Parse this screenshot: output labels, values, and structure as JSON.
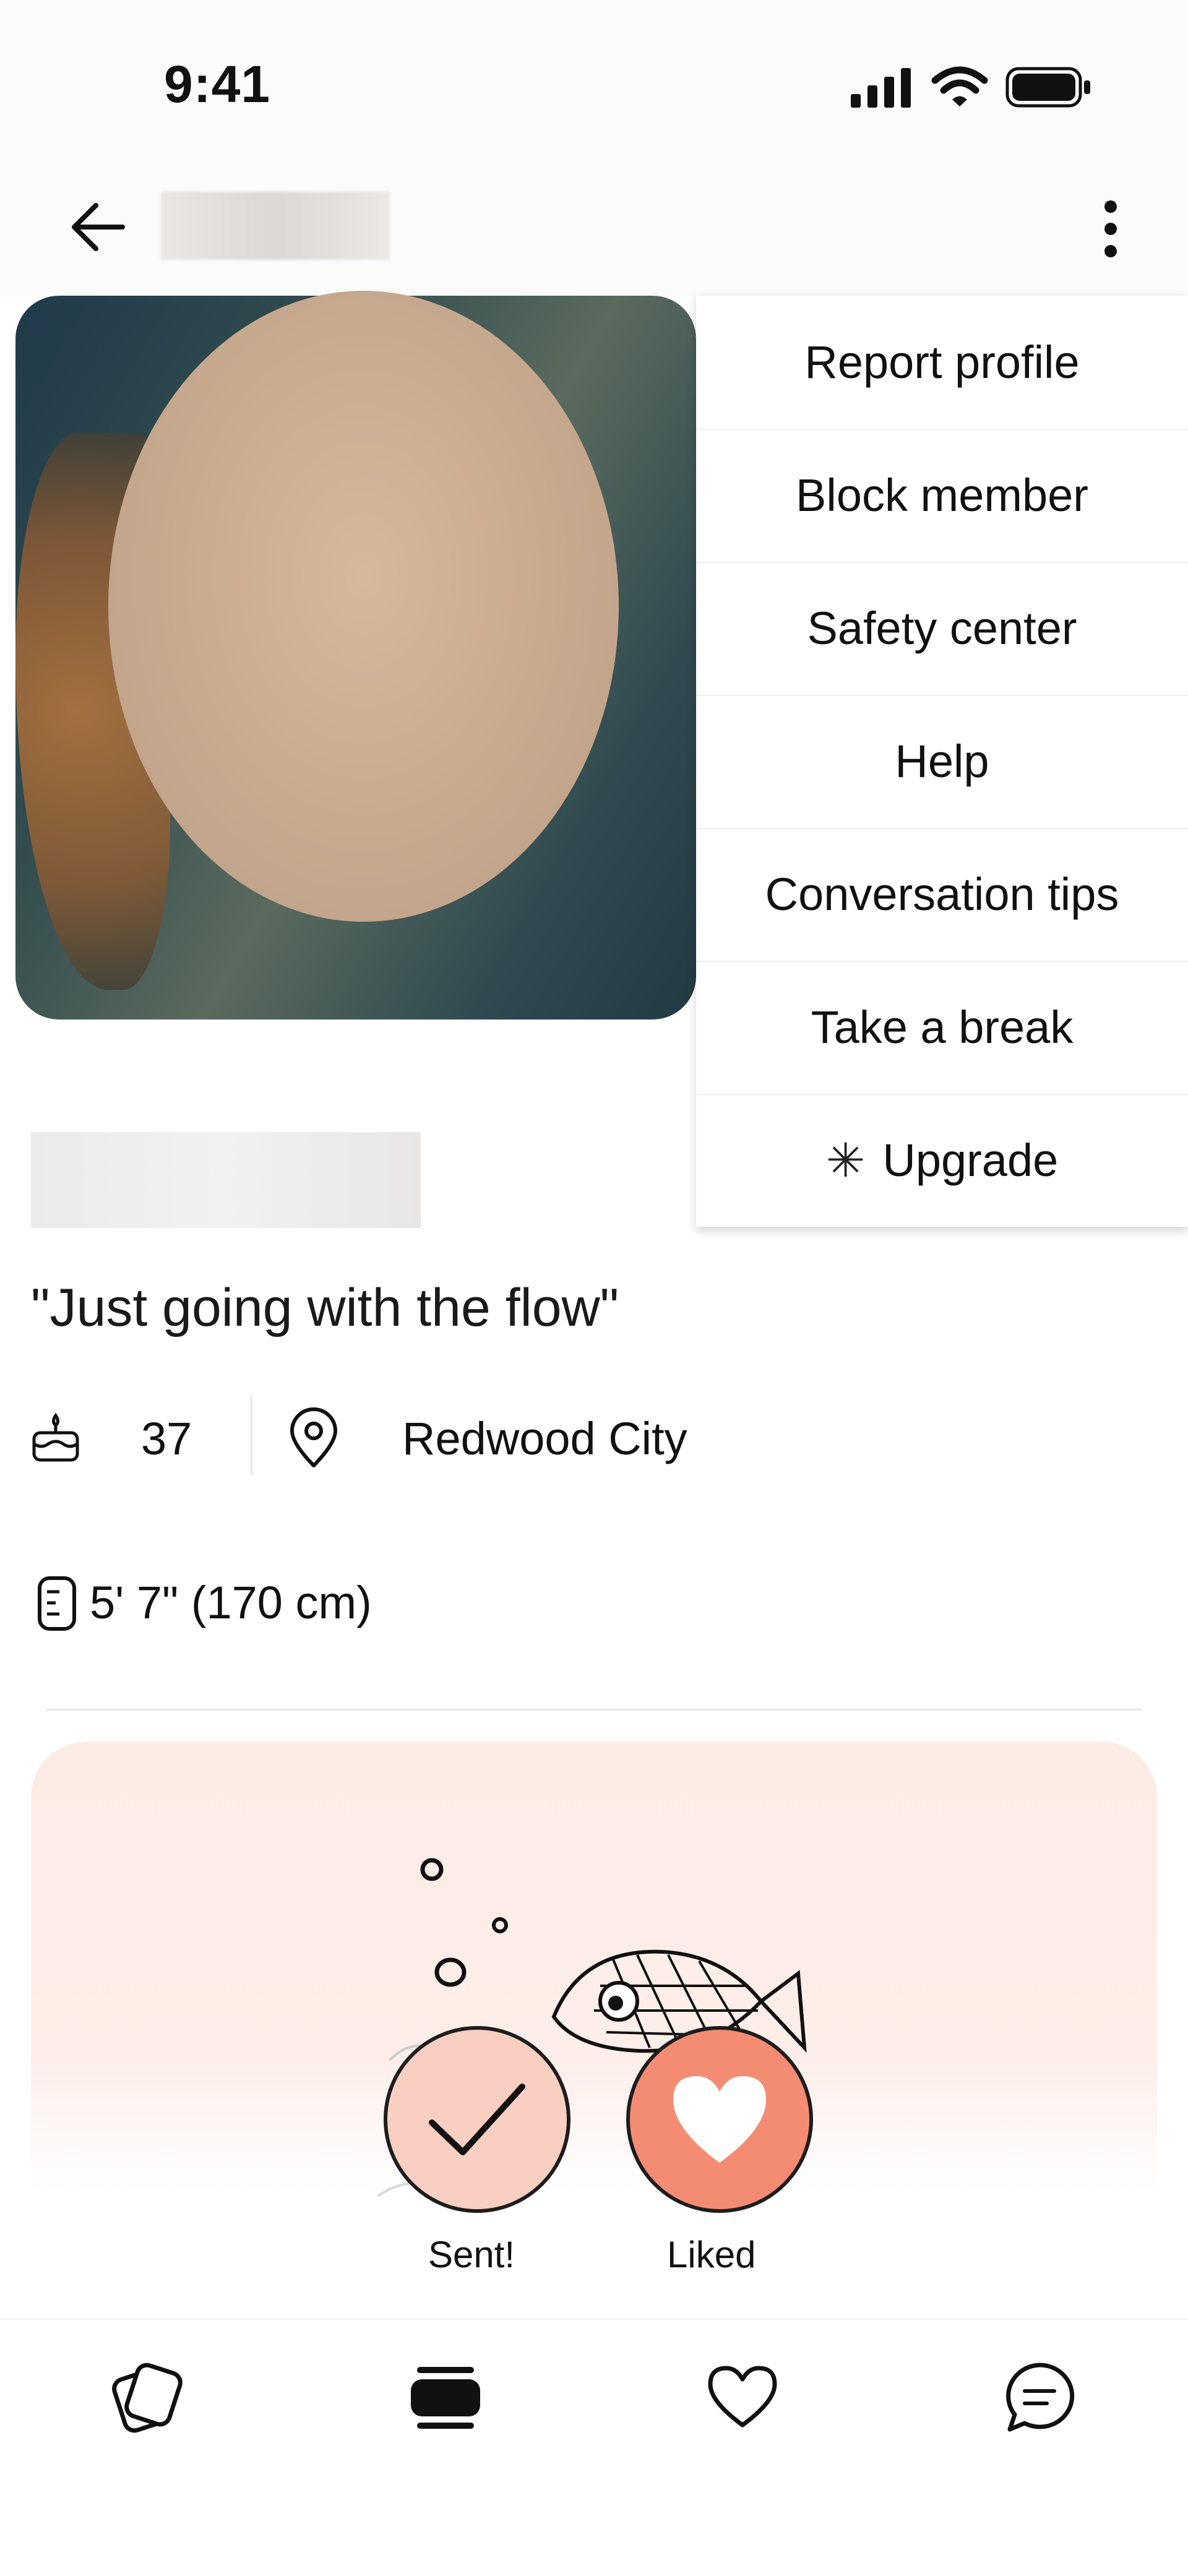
{
  "status_bar": {
    "time": "9:41",
    "icons": [
      "cellular-signal-icon",
      "wifi-icon",
      "battery-icon"
    ]
  },
  "header": {
    "back_icon": "arrow-left-icon",
    "more_icon": "vertical-ellipsis-icon"
  },
  "menu": {
    "items": [
      {
        "label": "Report profile"
      },
      {
        "label": "Block member"
      },
      {
        "label": "Safety center"
      },
      {
        "label": "Help"
      },
      {
        "label": "Conversation tips"
      },
      {
        "label": "Take a break"
      },
      {
        "label": "Upgrade",
        "icon": "asterisk-icon",
        "glyph": "✳"
      }
    ]
  },
  "profile": {
    "tagline": "\"Just going with the flow\"",
    "age": "37",
    "location": "Redwood City",
    "height": "5' 7\" (170 cm)"
  },
  "card": {
    "sent_label": "Sent!",
    "liked_label": "Liked"
  },
  "bottom_nav": {
    "items": [
      {
        "name": "discover",
        "icon": "cards-icon"
      },
      {
        "name": "profile",
        "icon": "stacked-card-icon"
      },
      {
        "name": "likes",
        "icon": "heart-icon"
      },
      {
        "name": "messages",
        "icon": "chat-bubble-icon"
      }
    ]
  },
  "colors": {
    "card_background": "#fdebe6",
    "sent_button": "#f9cfc2",
    "liked_button": "#f48c73"
  }
}
